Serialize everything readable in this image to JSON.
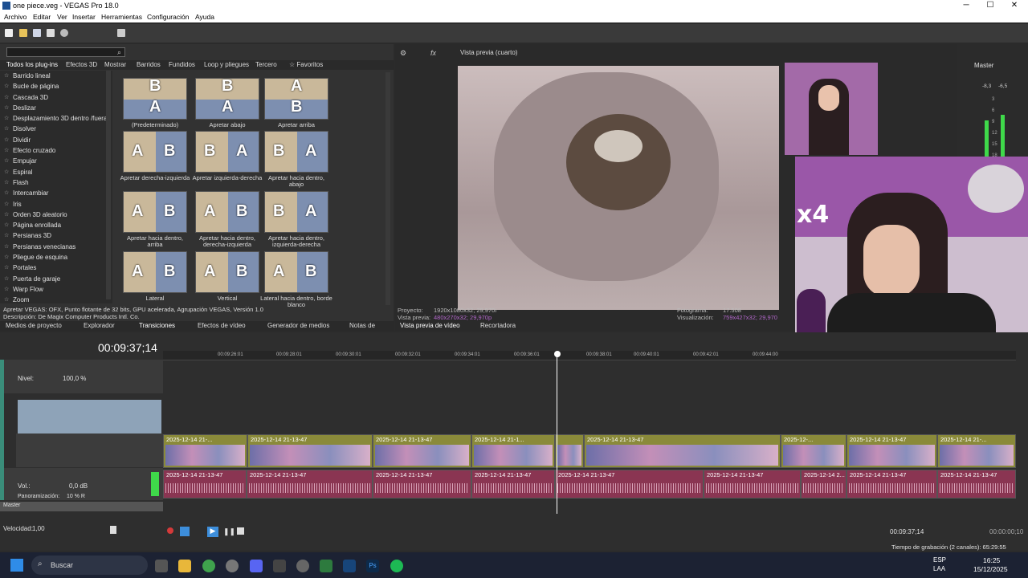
{
  "window": {
    "title": "one piece.veg - VEGAS Pro 18.0",
    "min": "─",
    "max": "☐",
    "close": "✕"
  },
  "menu": [
    "Archivo",
    "Editar",
    "Ver",
    "Insertar",
    "Herramientas",
    "Configuración",
    "Ayuda"
  ],
  "plugin_tabs": [
    "Todos los plug-ins",
    "Efectos 3D",
    "Mostrar",
    "Barridos",
    "Fundidos",
    "Loop y pliegues",
    "Tercero",
    "☆ Favoritos"
  ],
  "plugins": [
    "Barrido lineal",
    "Bucle de página",
    "Cascada 3D",
    "Deslizar",
    "Desplazamiento 3D dentro /fuera",
    "Disolver",
    "Dividir",
    "Efecto cruzado",
    "Empujar",
    "Espiral",
    "Flash",
    "Intercambiar",
    "Iris",
    "Orden 3D aleatorio",
    "Página enrollada",
    "Persianas 3D",
    "Persianas venecianas",
    "Pliegue de esquina",
    "Portales",
    "Puerta de garaje",
    "Warp Flow",
    "Zoom"
  ],
  "thumbs": [
    {
      "label": "(Predeterminado)",
      "a": "B",
      "b": "A"
    },
    {
      "label": "Apretar abajo",
      "a": "B",
      "b": "A"
    },
    {
      "label": "Apretar arriba",
      "a": "A",
      "b": "B"
    },
    {
      "label": "Apretar derecha-izquierda",
      "a": "A",
      "b": "B"
    },
    {
      "label": "Apretar izquierda-derecha",
      "a": "B",
      "b": "A"
    },
    {
      "label": "Apretar hacia dentro, abajo",
      "a": "B",
      "b": "A"
    },
    {
      "label": "Apretar hacia dentro, arriba",
      "a": "A",
      "b": "B"
    },
    {
      "label": "Apretar hacia dentro, derecha-izquierda",
      "a": "A",
      "b": "B"
    },
    {
      "label": "Apretar hacia dentro, izquierda-derecha",
      "a": "B",
      "b": "A"
    },
    {
      "label": "Lateral",
      "a": "A",
      "b": "B"
    },
    {
      "label": "Vertical",
      "a": "A",
      "b": "B"
    },
    {
      "label": "Lateral hacia dentro, borde blanco",
      "a": "A",
      "b": "B"
    }
  ],
  "plugin_desc": "Apretar VEGAS: OFX, Punto flotante de 32 bits, GPU acelerada, Agrupación VEGAS, Versión 1.0",
  "plugin_desc2": "Descripción: De Magix Computer Products Intl. Co.",
  "left_tabs": [
    "Medios de proyecto",
    "Explorador",
    "Transiciones",
    "Efectos de vídeo",
    "Generador de medios",
    "Notas de"
  ],
  "preview": {
    "mode": "Vista previa (cuarto)",
    "proyecto_label": "Proyecto:",
    "proyecto": "1920x1080x32; 29,970i",
    "vista_label": "Vista previa:",
    "vista": "480x270x32; 29,970p",
    "foto_label": "Fotograma:",
    "foto": "17.508",
    "visual_label": "Visualización:",
    "visual": "759x427x32; 29,970",
    "tabs": [
      "Vista previa de vídeo",
      "Recortadora"
    ]
  },
  "master": {
    "label": "Master",
    "l": "-8,3",
    "r": "-6,5",
    "scale": [
      "3",
      "6",
      "9",
      "12",
      "15",
      "18"
    ]
  },
  "overlay_text": "x4",
  "timeline": {
    "timecode": "00:09:37;14",
    "nivel_label": "Nivel:",
    "nivel": "100,0 %",
    "vol_label": "Vol.:",
    "vol": "0,0 dB",
    "pan_label": "Panoramización:",
    "pan": "10 % R",
    "master_label": "Master",
    "ticks": [
      "00:09:26:01",
      "00:09:28:01",
      "00:09:30:01",
      "00:09:32:01",
      "00:09:34:01",
      "00:09:36:01",
      "00:09:38:01",
      "00:09:40:01",
      "00:09:42:01",
      "00:09:44:00"
    ],
    "video_clips": [
      "2025-12-14 21-...",
      "2025-12-14 21-13-47",
      "2025-12-14 21-13-47",
      "2025-12-14 21-1...",
      "",
      "2025-12-14 21-13-47",
      "2025-12-...",
      "2025-12-14 21-13-47",
      "2025-12-14 21-..."
    ],
    "audio_clips": [
      "2025-12-14 21-13-47",
      "2025-12-14 21-13-47",
      "2025-12-14 21-13-47",
      "2025-12-14 21-13-47",
      "2025-12-14 21-13-47",
      "2025-12-14 21-13-47",
      "2025-12-14 2...",
      "2025-12-14 21-13-47",
      "2025-12-14 21-13-47"
    ],
    "velocidad_label": "Velocidad:",
    "velocidad": "1,00",
    "end_time": "00:09:37;14",
    "end_time2": "00:00:00;10",
    "rec_time": "Tiempo de grabación (2 canales): 65:29:55"
  },
  "taskbar": {
    "search": "Buscar",
    "lang": "ESP",
    "lang2": "LAA",
    "time": "16:25",
    "date": "15/12/2025"
  }
}
